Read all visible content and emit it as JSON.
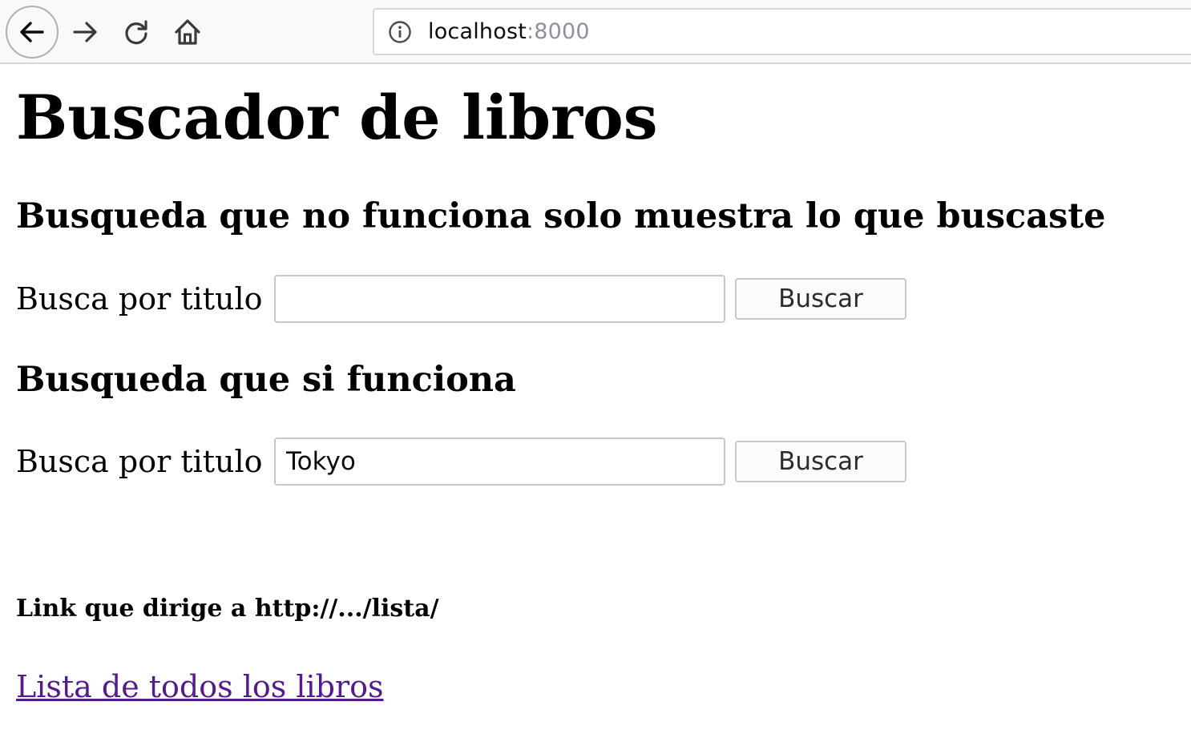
{
  "browser": {
    "url_host": "localhost",
    "url_port": ":8000"
  },
  "page": {
    "title": "Buscador de libros",
    "section_broken": {
      "heading": "Busqueda que no funciona solo muestra lo que buscaste",
      "label": "Busca por titulo",
      "input_value": "",
      "button_label": "Buscar"
    },
    "section_working": {
      "heading": "Busqueda que si funciona",
      "label": "Busca por titulo",
      "input_value": "Tokyo",
      "button_label": "Buscar"
    },
    "link_note": "Link que dirige a http://.../lista/",
    "link_text": "Lista de todos los libros",
    "link_color": "#551a8b"
  }
}
